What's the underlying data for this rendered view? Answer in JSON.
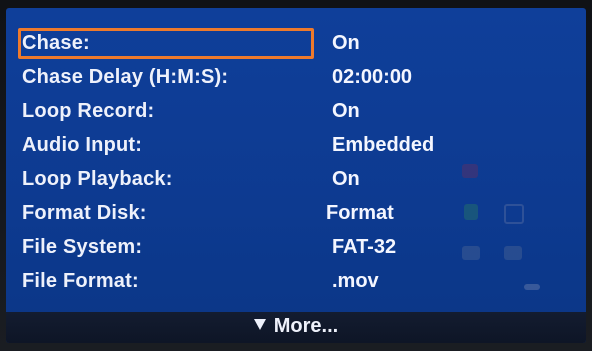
{
  "menu": {
    "items": [
      {
        "label": "Chase:",
        "value": "On"
      },
      {
        "label": "Chase Delay (H:M:S):",
        "value": "02:00:00"
      },
      {
        "label": "Loop Record:",
        "value": "On"
      },
      {
        "label": "Audio Input:",
        "value": "Embedded"
      },
      {
        "label": "Loop Playback:",
        "value": "On"
      },
      {
        "label": "Format Disk:",
        "value": "Format"
      },
      {
        "label": "File System:",
        "value": "FAT-32"
      },
      {
        "label": "File Format:",
        "value": ".mov"
      }
    ],
    "selected_index": 0
  },
  "footer": {
    "more_label": "More..."
  },
  "colors": {
    "screen_bg": "#0f3f9a",
    "selection_border": "#ee7a2c",
    "text": "#eef1fb",
    "footer_bg": "#131c30"
  }
}
